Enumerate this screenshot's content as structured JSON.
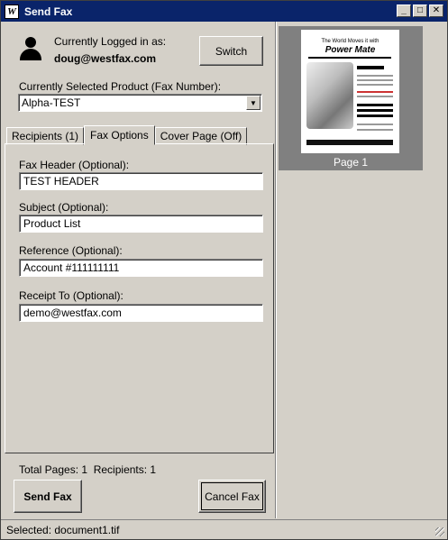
{
  "window": {
    "title": "Send Fax",
    "icon_label": "W",
    "controls": {
      "minimize": "_",
      "maximize": "□",
      "close": "✕"
    }
  },
  "account": {
    "logged_label": "Currently Logged in as:",
    "user": "doug@westfax.com",
    "switch_label": "Switch"
  },
  "product": {
    "label": "Currently Selected Product (Fax Number):",
    "selected": "Alpha-TEST",
    "arrow": "▼"
  },
  "tabs": [
    {
      "label": "Recipients (1)"
    },
    {
      "label": "Fax Options"
    },
    {
      "label": "Cover Page (Off)"
    }
  ],
  "fax_options": {
    "header_label": "Fax Header (Optional):",
    "header_value": "TEST HEADER",
    "subject_label": "Subject (Optional):",
    "subject_value": "Product List",
    "reference_label": "Reference (Optional):",
    "reference_value": "Account #111111111",
    "receipt_label": "Receipt To (Optional):",
    "receipt_value": "demo@westfax.com"
  },
  "summary": {
    "text": "Total Pages: 1  Recipients: 1"
  },
  "actions": {
    "send_label": "Send Fax",
    "cancel_label": "Cancel Fax"
  },
  "preview": {
    "doc_title_line": "The World Moves it with",
    "doc_brand": "Power Mate",
    "page_label": "Page 1"
  },
  "status": {
    "text": "Selected: document1.tif"
  }
}
